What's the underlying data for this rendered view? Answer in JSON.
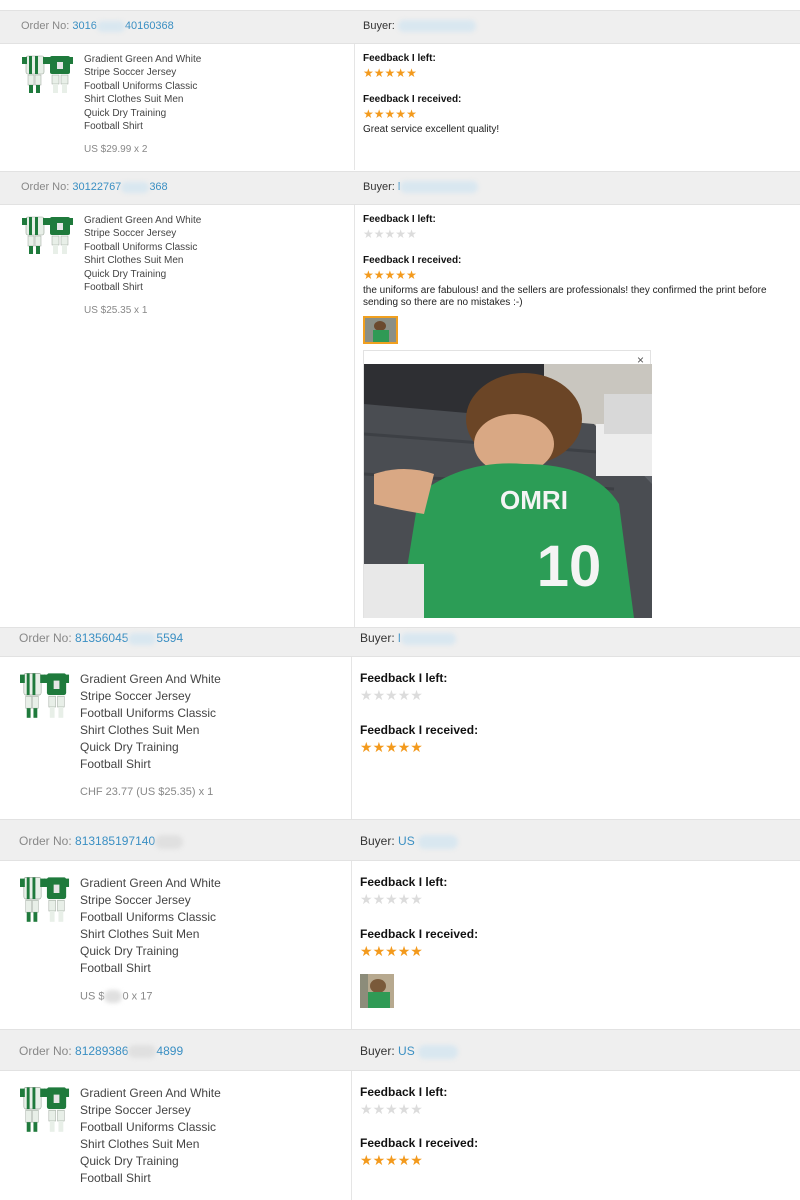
{
  "product_title_lines": [
    "Gradient Green And White",
    "Stripe Soccer Jersey",
    "Football Uniforms Classic",
    "Shirt Clothes Suit Men",
    "Quick Dry Training",
    "Football Shirt"
  ],
  "labels": {
    "order_no": "Order No:",
    "buyer": "Buyer:",
    "feedback_left": "Feedback I left:",
    "feedback_received": "Feedback I received:"
  },
  "orders": [
    {
      "order_no_start": "3016",
      "order_no_end": "40160368",
      "buyer_name": "",
      "price": "US $29.99 x 2",
      "left_rating": 5,
      "received_rating": 5,
      "comment": "Great service excellent quality!"
    },
    {
      "order_no_start": "30122767",
      "order_no_end": "368",
      "buyer_name": "l",
      "price": "US $25.35 x 1",
      "left_rating": 0,
      "received_rating": 5,
      "comment": "the uniforms are fabulous! and the sellers are professionals! they confirmed the print before sending so there are no mistakes :-)",
      "close_symbol": "×",
      "photo_jersey_name": "OMRI",
      "photo_jersey_number": "10"
    },
    {
      "order_no_start": "81356045",
      "order_no_end": "5594",
      "buyer_name": "l",
      "price": "CHF 23.77 (US $25.35) x 1",
      "left_rating": 0,
      "received_rating": 5
    },
    {
      "order_no_start": "813185197140",
      "order_no_end": "",
      "buyer_name": "US",
      "price_start": "US $",
      "price_end": "0 x 17",
      "left_rating": 0,
      "received_rating": 5
    },
    {
      "order_no_start": "81289386",
      "order_no_end": "4899",
      "buyer_name": "US",
      "left_rating": 0,
      "received_rating": 5
    }
  ],
  "colors": {
    "link": "#3a8fc3",
    "star_on": "#f39a1d",
    "star_off": "#dcdcdc",
    "header_bg": "#efefef",
    "jersey_green": "#1f7a3c"
  },
  "icons": {
    "star": "★",
    "close": "close-icon"
  }
}
